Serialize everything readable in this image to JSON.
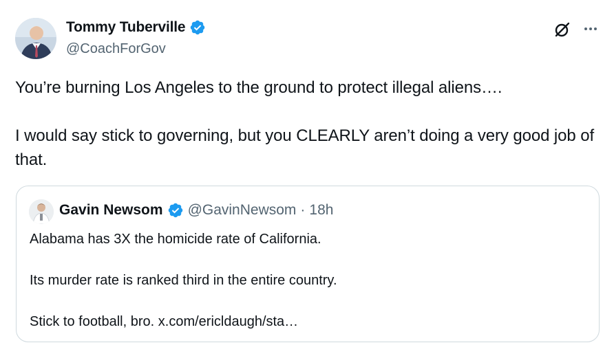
{
  "tweet": {
    "author": {
      "display_name": "Tommy Tuberville",
      "handle": "@CoachForGov",
      "verified": true
    },
    "paragraphs": [
      "You’re burning Los Angeles to the ground to protect illegal aliens….",
      "I would say stick to governing, but you CLEARLY aren’t doing a very good job of that."
    ]
  },
  "quoted_tweet": {
    "author": {
      "display_name": "Gavin Newsom",
      "handle": "@GavinNewsom",
      "verified": true
    },
    "separator": "·",
    "time": "18h",
    "paragraphs": [
      "Alabama has 3X the homicide rate of California.",
      "Its murder rate is ranked third in the entire country.",
      "Stick to football, bro. x.com/ericldaugh/sta…"
    ]
  },
  "icons": {
    "verified": "verified-badge-icon",
    "grok": "grok-icon",
    "more": "more-icon"
  },
  "colors": {
    "text_primary": "#0f1419",
    "text_secondary": "#536471",
    "verified_blue": "#1d9bf0",
    "border": "#cfd9de"
  }
}
